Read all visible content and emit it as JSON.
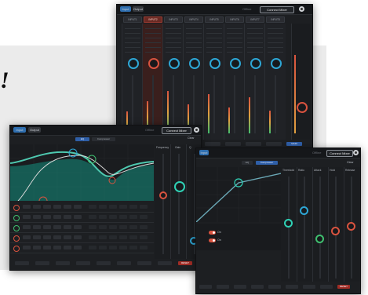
{
  "backdrop": {
    "glyph": "!"
  },
  "mixer": {
    "topbar": {
      "tab_active": "Input",
      "tab_other": "Output",
      "connect_label": "Connect Mixer",
      "status": "Offline"
    },
    "channels": [
      "INPUT1",
      "INPUT2",
      "INPUT3",
      "INPUT4",
      "INPUT5",
      "INPUT6",
      "INPUT7",
      "INPUT8"
    ],
    "selected_channel": 1,
    "bottom_buttons": [
      "",
      "",
      "",
      "",
      "",
      "",
      "",
      "",
      "MAIN"
    ]
  },
  "eq_window": {
    "topbar": {
      "tab_active": "Input",
      "tab_other": "Output",
      "connect_label": "Connect Mixer",
      "status": "Offline"
    },
    "mode_tabs": [
      "EQ",
      "Compressor"
    ],
    "selected_mode": 0,
    "side_columns": [
      "Frequency",
      "Gain",
      "Q"
    ],
    "header_right": "Clear",
    "bottom_buttons": [
      "",
      "",
      "",
      "",
      "",
      "",
      "",
      "",
      "RESET"
    ]
  },
  "comp_window": {
    "topbar": {
      "tab_active": "Input",
      "connect_label": "Connect Mixer",
      "status": "Offline"
    },
    "mode_tabs": [
      "EQ",
      "Compressor"
    ],
    "selected_mode": 1,
    "side_columns": [
      "Threshold",
      "Ratio",
      "Attack",
      "Hold",
      "Release"
    ],
    "header_right": "Clear",
    "toggle_labels": [
      "On",
      "On"
    ],
    "bottom_buttons": [
      "",
      "",
      "",
      "",
      "",
      "",
      "",
      "",
      "RESET"
    ]
  },
  "colors": {
    "accent_red": "#d9533f",
    "accent_blue": "#2f6fb0",
    "eq_fill": "#1e9f8a",
    "panel": "#1d1f22"
  }
}
